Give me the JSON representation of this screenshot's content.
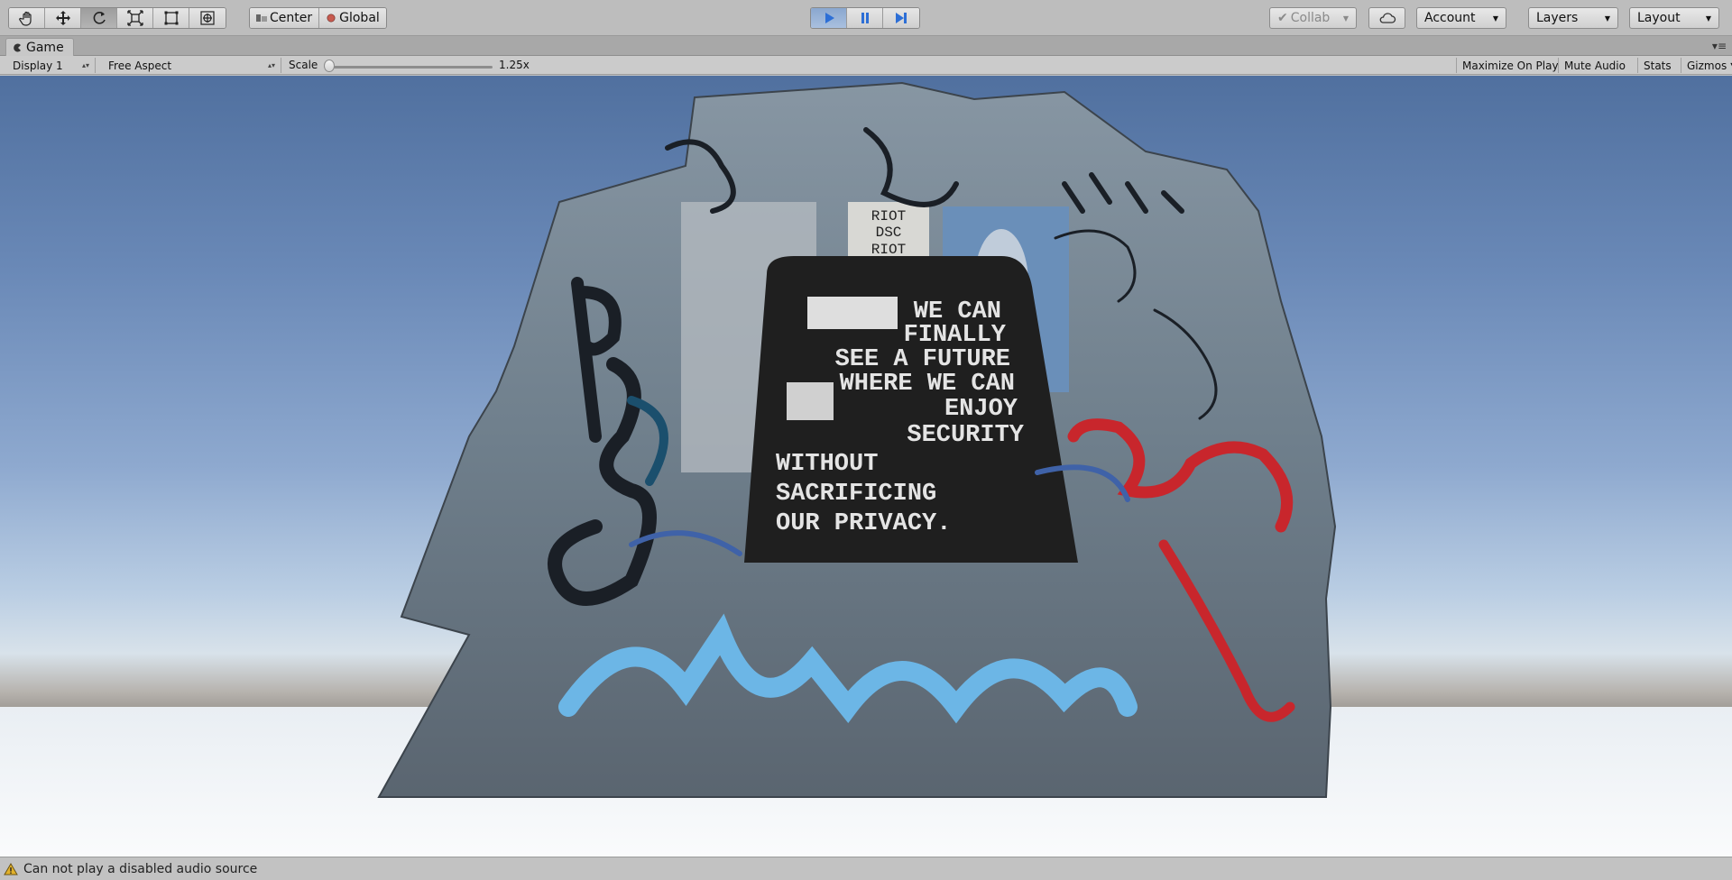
{
  "toolbar": {
    "transform_tools": [
      "hand-tool",
      "move-tool",
      "rotate-tool",
      "scale-tool",
      "rect-tool",
      "transform-tool"
    ],
    "active_tool": "rotate-tool",
    "pivot_mode": "Center",
    "pivot_rotation": "Global",
    "playback": {
      "playing": true,
      "paused": false
    },
    "collab_label": "Collab",
    "account_label": "Account",
    "layers_label": "Layers",
    "layout_label": "Layout"
  },
  "game_view": {
    "tab_label": "Game",
    "display": "Display 1",
    "aspect": "Free Aspect",
    "scale_label": "Scale",
    "scale_value": "1.25x",
    "scale_fraction": 0.0,
    "maximize_on_play": "Maximize On Play",
    "mute_audio": "Mute Audio",
    "stats": "Stats",
    "gizmos": "Gizmos"
  },
  "scene": {
    "poster_lines": [
      "WE CAN",
      "FINALLY",
      "SEE A FUTURE",
      "WHERE WE CAN",
      "ENJOY",
      "SECURITY",
      "WITHOUT",
      "SACRIFICING",
      "OUR PRIVACY."
    ],
    "sticker_text": "RIOT DSC RIOT",
    "colors": {
      "sky_top": "#50709f",
      "poster": "#1f1f1f",
      "graffiti_red": "#c8262c",
      "graffiti_blue": "#6cb6e6",
      "graffiti_black": "#1a1f26"
    }
  },
  "status": {
    "message": "Can not play a disabled audio source"
  }
}
